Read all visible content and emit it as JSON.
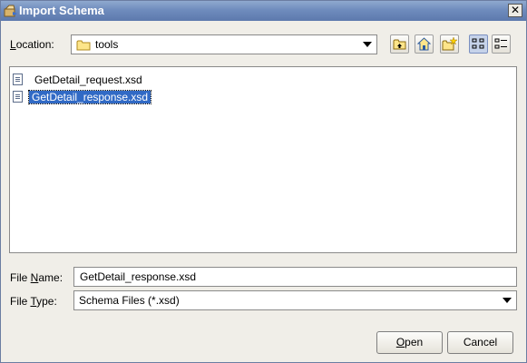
{
  "window": {
    "title": "Import Schema",
    "close_label": "✕"
  },
  "location": {
    "label_prefix": "",
    "label_hotkey": "L",
    "label_rest": "ocation:",
    "value": "tools"
  },
  "toolbar": {
    "buttons": [
      {
        "name": "up-folder-button",
        "icon": "up-folder-icon"
      },
      {
        "name": "home-button",
        "icon": "home-icon"
      },
      {
        "name": "new-folder-button",
        "icon": "new-folder-icon"
      },
      {
        "name": "list-view-button",
        "icon": "list-view-icon",
        "active": true
      },
      {
        "name": "details-view-button",
        "icon": "details-view-icon"
      }
    ]
  },
  "files": [
    {
      "name": "GetDetail_request.xsd",
      "selected": false
    },
    {
      "name": "GetDetail_response.xsd",
      "selected": true
    }
  ],
  "file_name": {
    "label_prefix": "File ",
    "label_hotkey": "N",
    "label_rest": "ame:",
    "value": "GetDetail_response.xsd"
  },
  "file_type": {
    "label_prefix": "File ",
    "label_hotkey": "T",
    "label_rest": "ype:",
    "value": "Schema Files (*.xsd)"
  },
  "buttons": {
    "open_hotkey": "O",
    "open_rest": "pen",
    "cancel": "Cancel"
  },
  "colors": {
    "title_bar": "#6f8cbd",
    "selection": "#316ac5",
    "dialog_bg": "#f0eee8"
  }
}
